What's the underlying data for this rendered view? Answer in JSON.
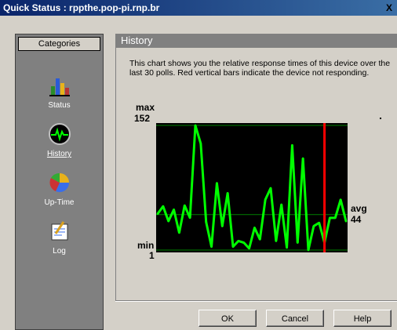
{
  "window": {
    "title": "Quick Status : rppthe.pop-pi.rnp.br",
    "close_label": "X"
  },
  "sidebar": {
    "header": "Categories",
    "items": [
      {
        "label": "Status",
        "icon": "bar-chart-icon"
      },
      {
        "label": "History",
        "icon": "heartbeat-icon"
      },
      {
        "label": "Up-Time",
        "icon": "pie-chart-icon"
      },
      {
        "label": "Log",
        "icon": "notepad-icon"
      }
    ]
  },
  "panel": {
    "title": "History",
    "description": "This chart shows you the relative response times of this device over the last 30 polls. Red vertical bars indicate the device not responding."
  },
  "chart_data": {
    "type": "line",
    "max_label": "max",
    "max_value": "152",
    "min_label": "min",
    "min_value": "1",
    "avg_label": "avg",
    "avg_value": "44",
    "ylim": [
      1,
      152
    ],
    "avg": 44,
    "values": [
      45,
      54,
      36,
      50,
      22,
      55,
      40,
      152,
      130,
      35,
      5,
      82,
      30,
      70,
      5,
      12,
      10,
      3,
      28,
      14,
      62,
      76,
      12,
      56,
      4,
      128,
      10,
      112,
      1,
      30,
      34,
      10,
      40,
      40,
      62,
      36
    ],
    "no_response_index": 31,
    "colors": {
      "background": "#000000",
      "line": "#00ff00",
      "grid": "#008000",
      "no_response": "#ff0000"
    }
  },
  "buttons": {
    "ok": "OK",
    "cancel": "Cancel",
    "help": "Help"
  }
}
